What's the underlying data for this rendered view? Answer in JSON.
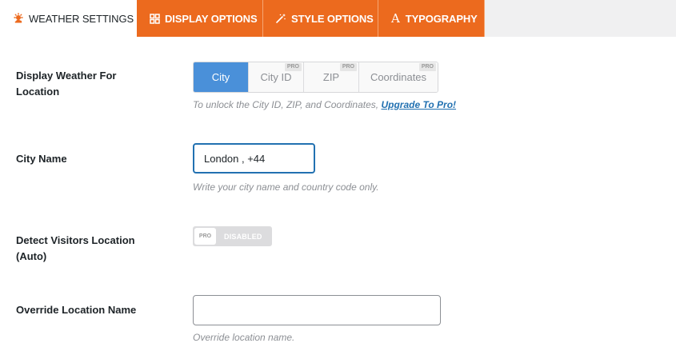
{
  "tabs": [
    {
      "label": "WEATHER SETTINGS",
      "icon": "weather-icon",
      "active": true
    },
    {
      "label": "DISPLAY OPTIONS",
      "icon": "grid-icon"
    },
    {
      "label": "STYLE OPTIONS",
      "icon": "magic-wand-icon"
    },
    {
      "label": "TYPOGRAPHY",
      "icon": "typography-icon",
      "glyph": "A"
    }
  ],
  "colors": {
    "accent": "#ec6a1e",
    "selected": "#4a90d9",
    "link": "#2271b1"
  },
  "fields": {
    "display_weather": {
      "label": "Display Weather For Location",
      "options": [
        {
          "label": "City",
          "selected": true
        },
        {
          "label": "City ID",
          "badge": "PRO"
        },
        {
          "label": "ZIP",
          "badge": "PRO"
        },
        {
          "label": "Coordinates",
          "badge": "PRO"
        }
      ],
      "help": "To unlock the City ID, ZIP, and Coordinates,",
      "help_link": "Upgrade To Pro!"
    },
    "city_name": {
      "label": "City Name",
      "value": "London , +44",
      "help": "Write your city name and country code only."
    },
    "detect_location": {
      "label": "Detect Visitors Location (Auto)",
      "toggle_badge": "PRO",
      "toggle_state": "DISABLED"
    },
    "override_location": {
      "label": "Override Location Name",
      "value": "",
      "help": "Override location name."
    }
  }
}
